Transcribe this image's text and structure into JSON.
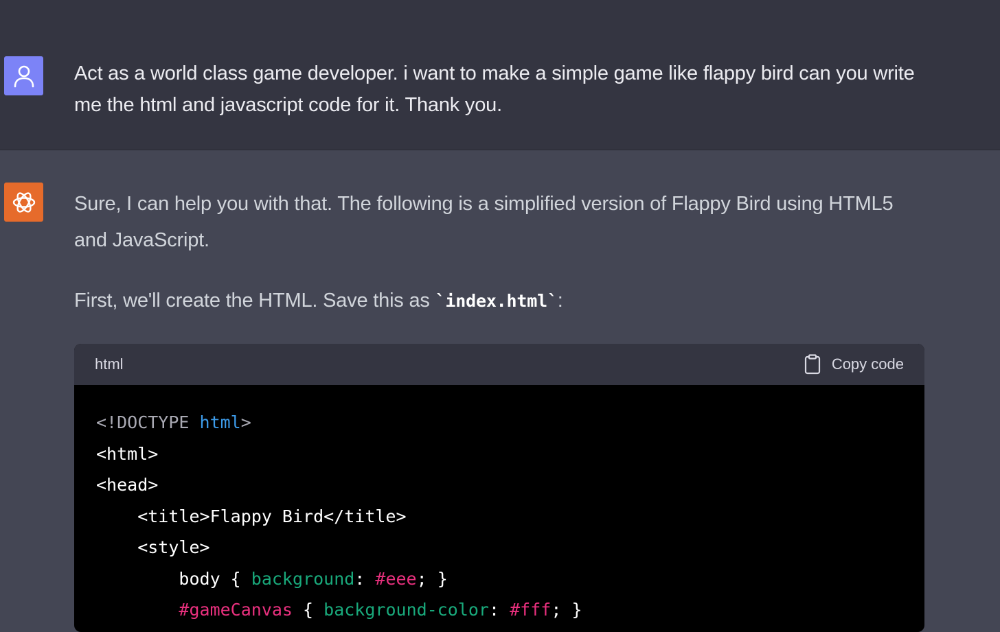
{
  "colors": {
    "user_bg": "#343541",
    "assistant_bg": "#444654",
    "user_avatar": "#7c83f7",
    "bot_avatar": "#e66b2b",
    "code_bg": "#000000",
    "code_header_bg": "#343541",
    "token_meta": "#a9a9b3",
    "token_tag_name": "#3d9be9",
    "token_property": "#19a97b",
    "token_value": "#e9307e"
  },
  "user_message": {
    "avatar_icon": "user-icon",
    "text": "Act as a world class game developer. i want to make a simple game like flappy bird can you write me the html and javascript code for it. Thank you."
  },
  "assistant_message": {
    "avatar_icon": "openai-logo-icon",
    "paragraph_1": "Sure, I can help you with that. The following is a simplified version of Flappy Bird using HTML5 and JavaScript.",
    "paragraph_2_before": "First, we'll create the HTML. Save this as ",
    "paragraph_2_code": "`index.html`",
    "paragraph_2_after": ":",
    "code_block": {
      "language": "html",
      "copy_label": "Copy code",
      "lines": [
        [
          {
            "t": "<!DOCTYPE ",
            "c": "meta"
          },
          {
            "t": "html",
            "c": "tag_name"
          },
          {
            "t": ">",
            "c": "meta"
          }
        ],
        [
          {
            "t": "<html>",
            "c": "plain"
          }
        ],
        [
          {
            "t": "<head>",
            "c": "plain"
          }
        ],
        [
          {
            "t": "    <title>Flappy Bird</title>",
            "c": "plain"
          }
        ],
        [
          {
            "t": "    <style>",
            "c": "plain"
          }
        ],
        [
          {
            "t": "        body { ",
            "c": "plain"
          },
          {
            "t": "background",
            "c": "property"
          },
          {
            "t": ": ",
            "c": "plain"
          },
          {
            "t": "#eee",
            "c": "value"
          },
          {
            "t": "; }",
            "c": "plain"
          }
        ],
        [
          {
            "t": "        ",
            "c": "plain"
          },
          {
            "t": "#gameCanvas",
            "c": "value"
          },
          {
            "t": " { ",
            "c": "plain"
          },
          {
            "t": "background-color",
            "c": "property"
          },
          {
            "t": ": ",
            "c": "plain"
          },
          {
            "t": "#fff",
            "c": "value"
          },
          {
            "t": "; }",
            "c": "plain"
          }
        ]
      ]
    }
  }
}
